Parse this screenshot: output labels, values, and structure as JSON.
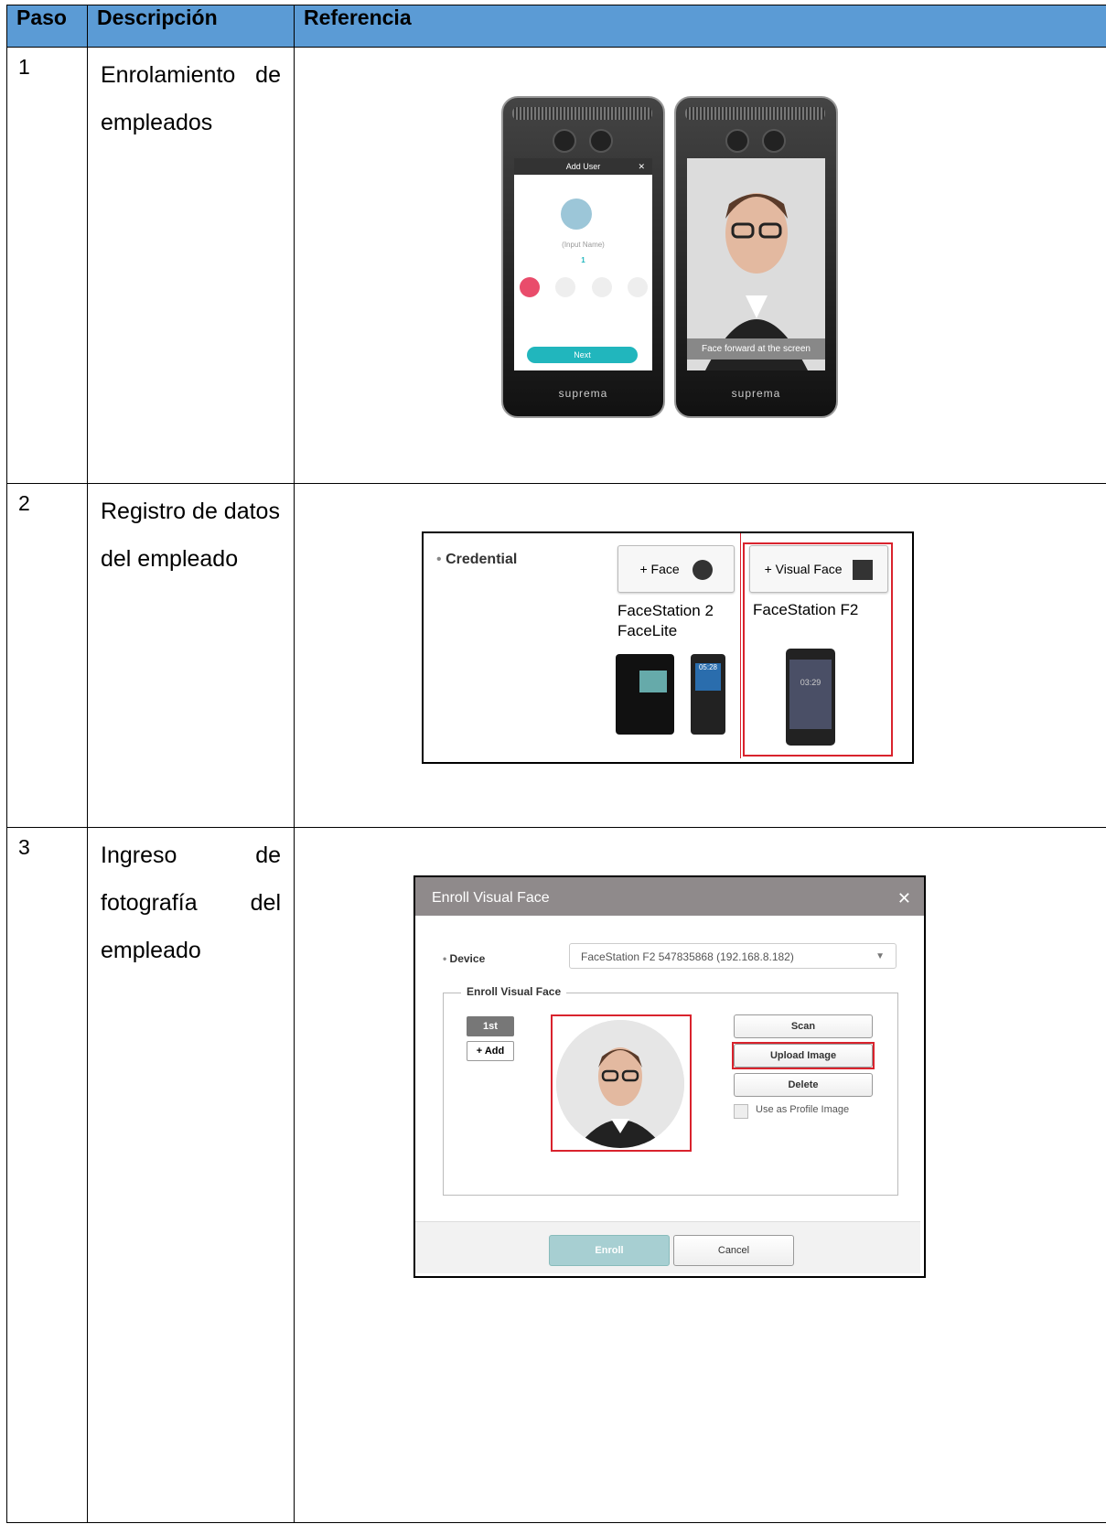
{
  "table": {
    "headers": [
      "Paso",
      "Descripción",
      "Referencia"
    ],
    "rows": [
      {
        "num": "1",
        "desc_lines": [
          "Enrolamiento de",
          "empleados"
        ]
      },
      {
        "num": "2",
        "desc_lines": [
          "Registro de datos",
          "del empleado"
        ]
      },
      {
        "num": "3",
        "desc_lines": [
          "Ingreso de",
          "fotografía del",
          "empleado"
        ]
      }
    ]
  },
  "devices": {
    "screen1_title": "Add User",
    "screen1_name_placeholder": "(Input Name)",
    "screen1_id": "1",
    "screen1_icons": [
      "Face",
      "Fingerprint",
      "Card",
      "PIN"
    ],
    "screen1_next": "Next",
    "screen2_caption": "Face forward at the screen",
    "brand": "suprema"
  },
  "credential": {
    "label": "Credential",
    "face_btn": "+ Face",
    "visual_face_btn": "+ Visual Face",
    "face_models": "FaceStation 2 FaceLite",
    "visual_model": "FaceStation F2",
    "clock1": "05:28",
    "clock2": "03:29"
  },
  "dialog": {
    "title": "Enroll Visual Face",
    "device_label": "Device",
    "device_value": "FaceStation F2 547835868 (192.168.8.182)",
    "group_label": "Enroll Visual Face",
    "tab_1st": "1st",
    "add": "+ Add",
    "scan": "Scan",
    "upload": "Upload Image",
    "delete": "Delete",
    "profile": "Use as Profile Image",
    "enroll": "Enroll",
    "cancel": "Cancel"
  },
  "colors": {
    "header_bg": "#5b9bd5",
    "highlight_red": "#d9232d",
    "teal": "#21b6bd",
    "dialog_head": "#8f8a8b"
  }
}
